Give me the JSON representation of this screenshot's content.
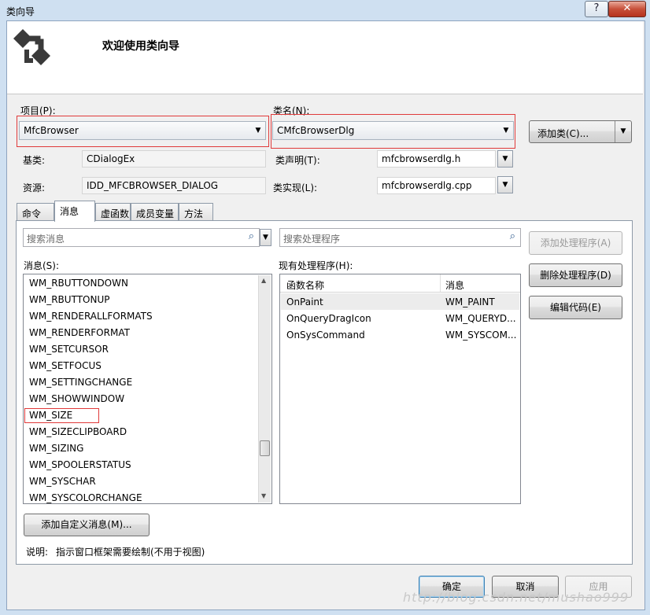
{
  "window": {
    "title": "类向导",
    "help_btn": "?",
    "close_btn": "✕"
  },
  "banner": {
    "title": "欢迎使用类向导"
  },
  "fields": {
    "project_label": "项目(P):",
    "project_value": "MfcBrowser",
    "classname_label": "类名(N):",
    "classname_value": "CMfcBrowserDlg",
    "add_class_button": "添加类(C)...",
    "base_label": "基类:",
    "base_value": "CDialogEx",
    "resource_label": "资源:",
    "resource_value": "IDD_MFCBROWSER_DIALOG",
    "decl_label": "类声明(T):",
    "decl_value": "mfcbrowserdlg.h",
    "impl_label": "类实现(L):",
    "impl_value": "mfcbrowserdlg.cpp"
  },
  "tabs": [
    "命令",
    "消息",
    "虚函数",
    "成员变量",
    "方法"
  ],
  "active_tab": "消息",
  "messages": {
    "search_placeholder": "搜索消息",
    "list_label": "消息(S):",
    "items": [
      "WM_RBUTTONDOWN",
      "WM_RBUTTONUP",
      "WM_RENDERALLFORMATS",
      "WM_RENDERFORMAT",
      "WM_SETCURSOR",
      "WM_SETFOCUS",
      "WM_SETTINGCHANGE",
      "WM_SHOWWINDOW",
      "WM_SIZE",
      "WM_SIZECLIPBOARD",
      "WM_SIZING",
      "WM_SPOOLERSTATUS",
      "WM_SYSCHAR",
      "WM_SYSCOLORCHANGE"
    ],
    "highlighted": "WM_SIZE",
    "add_custom_button": "添加自定义消息(M)..."
  },
  "handlers": {
    "search_placeholder": "搜索处理程序",
    "list_label": "现有处理程序(H):",
    "columns": [
      "函数名称",
      "消息"
    ],
    "rows": [
      [
        "OnPaint",
        "WM_PAINT"
      ],
      [
        "OnQueryDragIcon",
        "WM_QUERYD..."
      ],
      [
        "OnSysCommand",
        "WM_SYSCOM..."
      ]
    ]
  },
  "actions": {
    "add_handler": "添加处理程序(A)",
    "delete_handler": "删除处理程序(D)",
    "edit_code": "编辑代码(E)"
  },
  "description": {
    "label": "说明:",
    "text": "指示窗口框架需要绘制(不用于视图)"
  },
  "footer": {
    "ok": "确定",
    "cancel": "取消",
    "apply": "应用"
  },
  "watermark": "http://blog.csdn.net/mushao999",
  "colors": {
    "highlight_border": "#e03a3a",
    "dialog_bg": "#f0f0f0",
    "title_bg": "#cfe0f1"
  }
}
